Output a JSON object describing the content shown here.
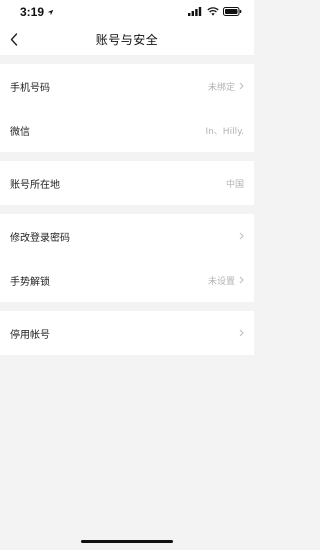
{
  "status_bar": {
    "time": "3:19",
    "location_icon": "location-arrow-icon",
    "signal_icon": "signal-icon",
    "wifi_icon": "wifi-icon",
    "battery_icon": "battery-icon"
  },
  "nav": {
    "title": "账号与安全",
    "back_icon": "chevron-left-icon"
  },
  "groups": [
    {
      "rows": [
        {
          "label": "手机号码",
          "value": "未绑定",
          "chevron": true
        },
        {
          "label": "微信",
          "value": "In、Hilly.",
          "chevron": false
        }
      ]
    },
    {
      "rows": [
        {
          "label": "账号所在地",
          "value": "中国",
          "chevron": false
        }
      ]
    },
    {
      "rows": [
        {
          "label": "修改登录密码",
          "value": "",
          "chevron": true
        },
        {
          "label": "手势解锁",
          "value": "未设置",
          "chevron": true
        }
      ]
    },
    {
      "rows": [
        {
          "label": "停用帐号",
          "value": "",
          "chevron": true
        }
      ]
    }
  ],
  "colors": {
    "background": "#f3f3f3",
    "card": "#ffffff",
    "secondary_text": "#b3b3b3"
  }
}
